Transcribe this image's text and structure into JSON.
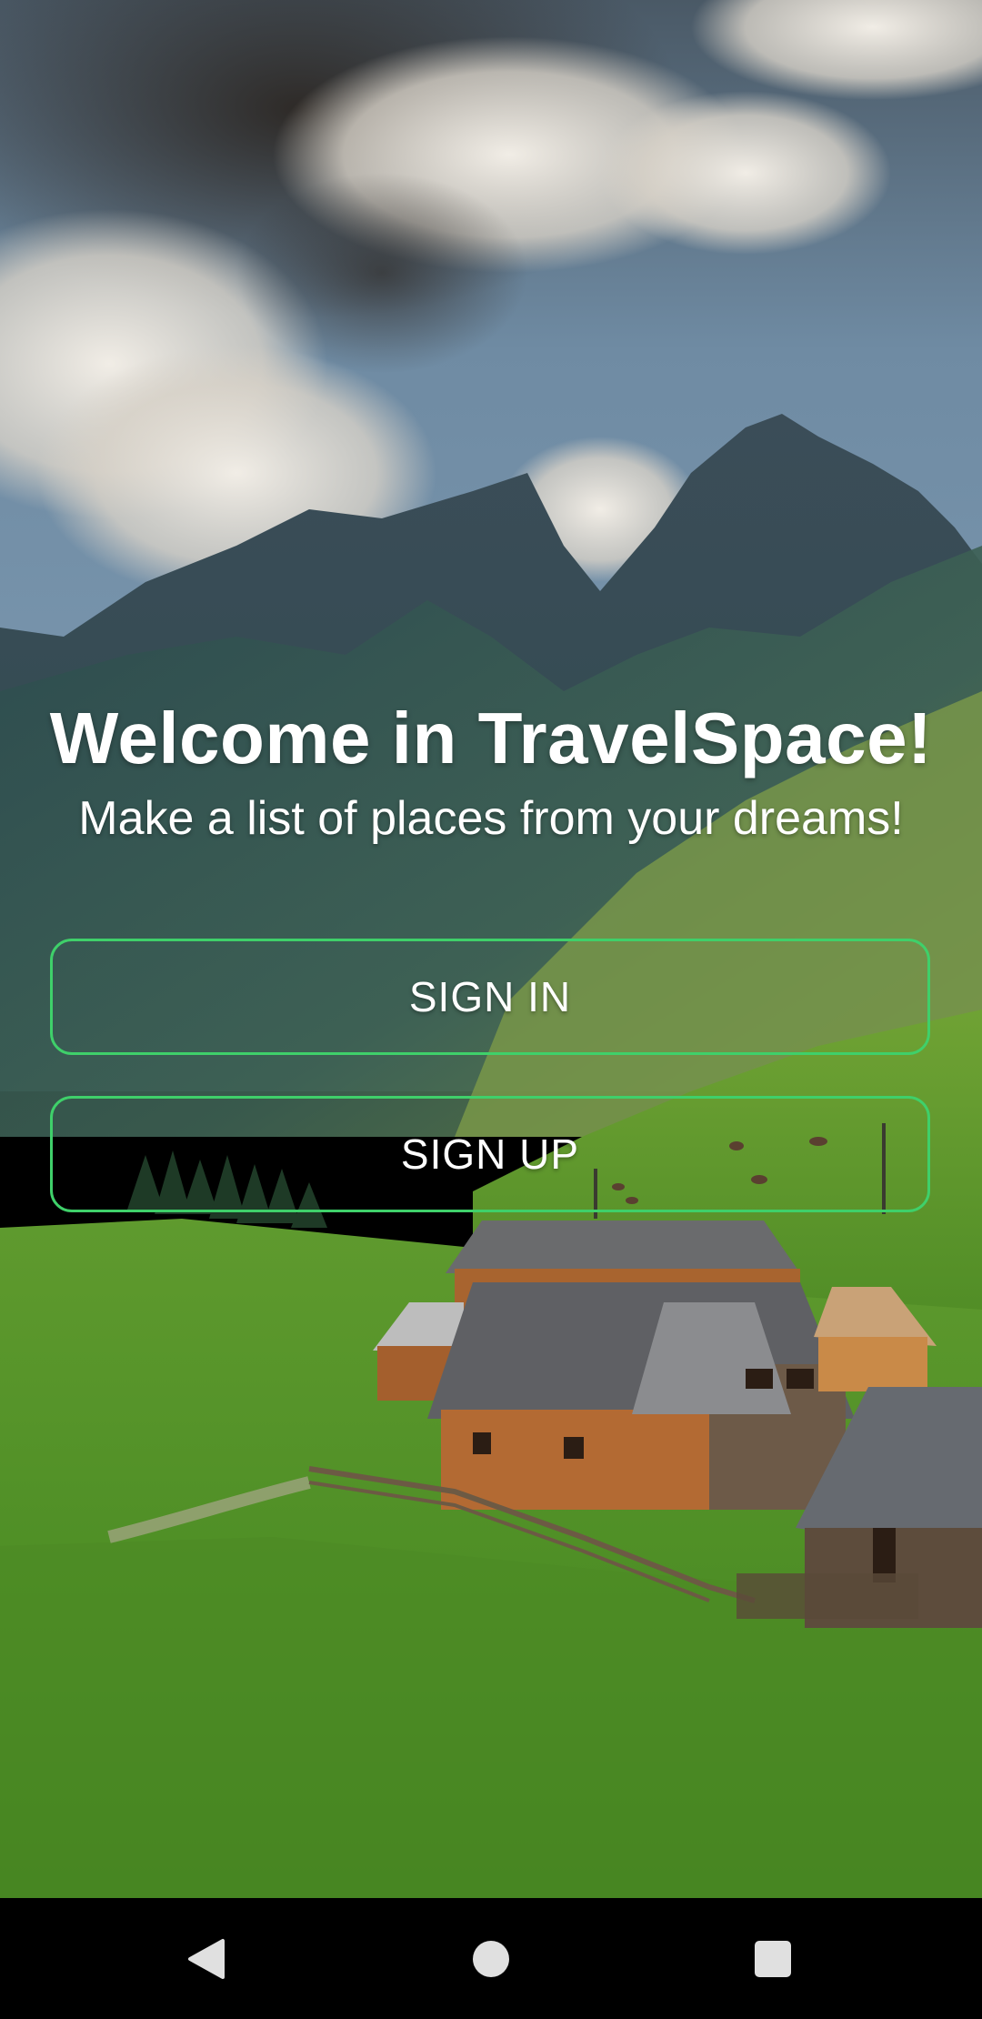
{
  "welcome": {
    "title": "Welcome in TravelSpace!",
    "subtitle": "Make a list of places from your dreams!"
  },
  "buttons": {
    "sign_in": "SIGN IN",
    "sign_up": "SIGN UP"
  },
  "colors": {
    "button_border": "#3fd06a",
    "text": "#ffffff",
    "nav_bar": "#000000"
  },
  "nav": {
    "back_icon": "back-triangle-icon",
    "home_icon": "home-circle-icon",
    "recents_icon": "recents-square-icon"
  }
}
